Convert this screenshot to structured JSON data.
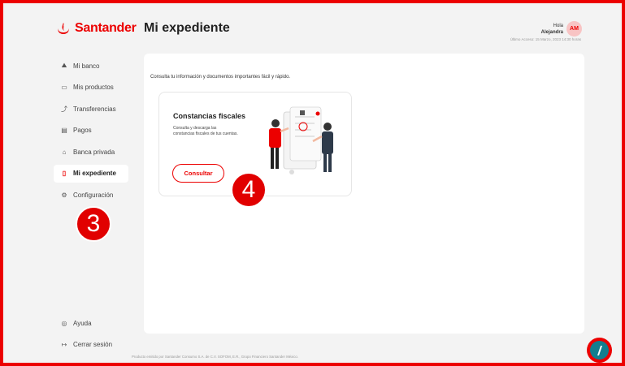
{
  "header": {
    "brand": "Santander",
    "page_title": "Mi expediente",
    "greeting": "Hola",
    "user_name": "Alejandra",
    "avatar_initials": "AM",
    "last_access": "Último Acceso: 15 Marzo, 2023 14:30 horas"
  },
  "sidebar": {
    "items": [
      {
        "label": "Mi banco",
        "icon": "bank-icon"
      },
      {
        "label": "Mis productos",
        "icon": "card-icon"
      },
      {
        "label": "Transferencias",
        "icon": "transfer-icon"
      },
      {
        "label": "Pagos",
        "icon": "payments-icon"
      },
      {
        "label": "Banca privada",
        "icon": "private-bank-icon"
      },
      {
        "label": "Mi expediente",
        "icon": "document-icon",
        "active": true
      },
      {
        "label": "Configuración",
        "icon": "gear-icon"
      }
    ],
    "bottom": [
      {
        "label": "Ayuda",
        "icon": "help-icon"
      },
      {
        "label": "Cerrar sesión",
        "icon": "logout-icon"
      }
    ]
  },
  "main": {
    "intro": "Consulta tu información y documentos importantes fácil y rápido.",
    "card": {
      "title": "Constancias fiscales",
      "description": "Consulta y descarga las constancias fiscales de tus cuentas.",
      "button": "Consultar"
    }
  },
  "footer": "Producto emitido por Santander Consumo S.A. de C.V. SOFOM, E.R., Grupo Financiero Santander México.",
  "steps": {
    "sidebar": "3",
    "card": "4"
  },
  "colors": {
    "brand": "#ec0000",
    "chat": "#137e8f",
    "background": "#f3f3f3"
  }
}
